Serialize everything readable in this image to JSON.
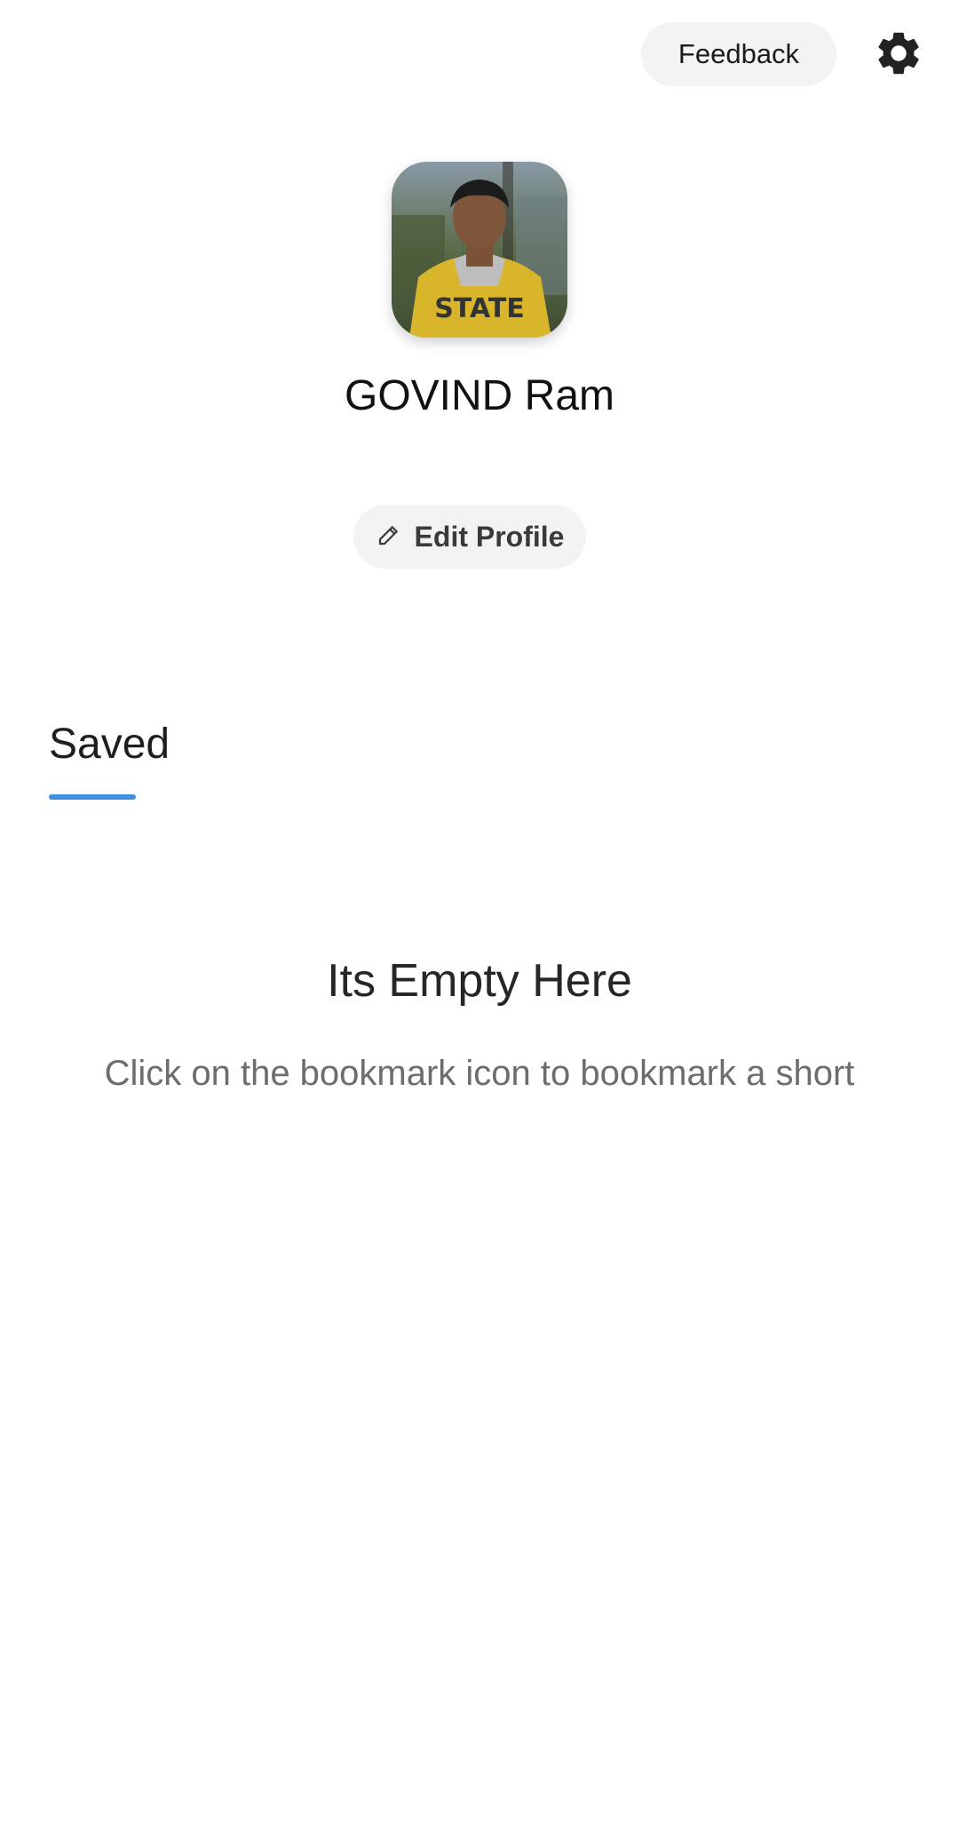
{
  "header": {
    "feedback_label": "Feedback",
    "settings_icon": "gear-icon"
  },
  "profile": {
    "name": "GOVIND Ram",
    "avatar_icon": "avatar-photo",
    "edit_label": "Edit Profile",
    "edit_icon": "pencil-icon"
  },
  "tabs": {
    "saved_label": "Saved",
    "active_color": "#3f8fe0"
  },
  "empty_state": {
    "title": "Its Empty Here",
    "description": "Click on the bookmark icon to bookmark a short"
  }
}
